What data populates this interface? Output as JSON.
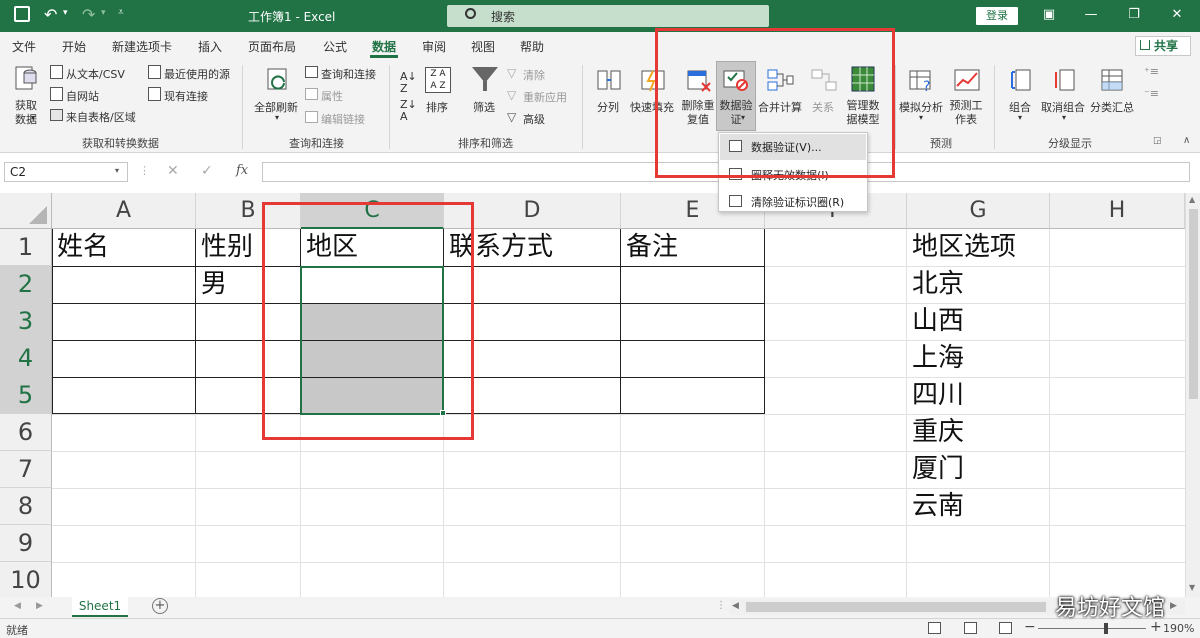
{
  "title_bar": {
    "autosave_icon": "save-icon",
    "window_title": "工作簿1 - Excel",
    "search_placeholder": "搜索",
    "login_label": "登录"
  },
  "menu": [
    "文件",
    "开始",
    "新建选项卡",
    "插入",
    "页面布局",
    "公式",
    "数据",
    "审阅",
    "视图",
    "帮助"
  ],
  "share_label": "共享",
  "ribbon": {
    "get_data": "获取数据",
    "from_text": "从文本/CSV",
    "from_web": "自网站",
    "from_table": "来自表格/区域",
    "recent_sources": "最近使用的源",
    "existing_conn": "现有连接",
    "group_get": "获取和转换数据",
    "refresh_all": "全部刷新",
    "queries_conn": "查询和连接",
    "properties": "属性",
    "edit_links": "编辑链接",
    "group_queries": "查询和连接",
    "sort": "排序",
    "filter": "筛选",
    "clear": "清除",
    "reapply": "重新应用",
    "advanced": "高级",
    "group_sort": "排序和筛选",
    "split": "分列",
    "flash_fill": "快速填充",
    "remove_dup": "删除重复值",
    "data_validation": "数据验证",
    "consolidate": "合并计算",
    "relations": "关系",
    "data_model": "管理数据模型",
    "what_if": "模拟分析",
    "forecast_sheet": "预测工作表",
    "group_forecast": "预测",
    "group_ungroup_1": "组合",
    "ungroup": "取消组合",
    "subtotal": "分类汇总",
    "group_outline": "分级显示"
  },
  "dropdown": {
    "items": [
      "数据验证(V)...",
      "圈释无效数据(I)",
      "清除验证标识圈(R)"
    ]
  },
  "formula_bar": {
    "name_box": "C2",
    "fx": "fx",
    "content": ""
  },
  "columns": [
    "A",
    "B",
    "C",
    "D",
    "E",
    "F",
    "G",
    "H"
  ],
  "rows": [
    "1",
    "2",
    "3",
    "4",
    "5",
    "6",
    "7",
    "8",
    "9",
    "10"
  ],
  "cells": {
    "A1": "姓名",
    "B1": "性别",
    "C1": "地区",
    "D1": "联系方式",
    "E1": "备注",
    "B2": "男",
    "G1": "地区选项",
    "G2": "北京",
    "G3": "山西",
    "G4": "上海",
    "G5": "四川",
    "G6": "重庆",
    "G7": "厦门",
    "G8": "云南"
  },
  "sheet_tab": "Sheet1",
  "status": {
    "ready": "就绪",
    "zoom": "190%"
  },
  "watermark": "易坊好文馆",
  "colors": {
    "excel_green": "#217346",
    "highlight_red": "#e53935",
    "selection_gray": "#c8c8c8"
  }
}
